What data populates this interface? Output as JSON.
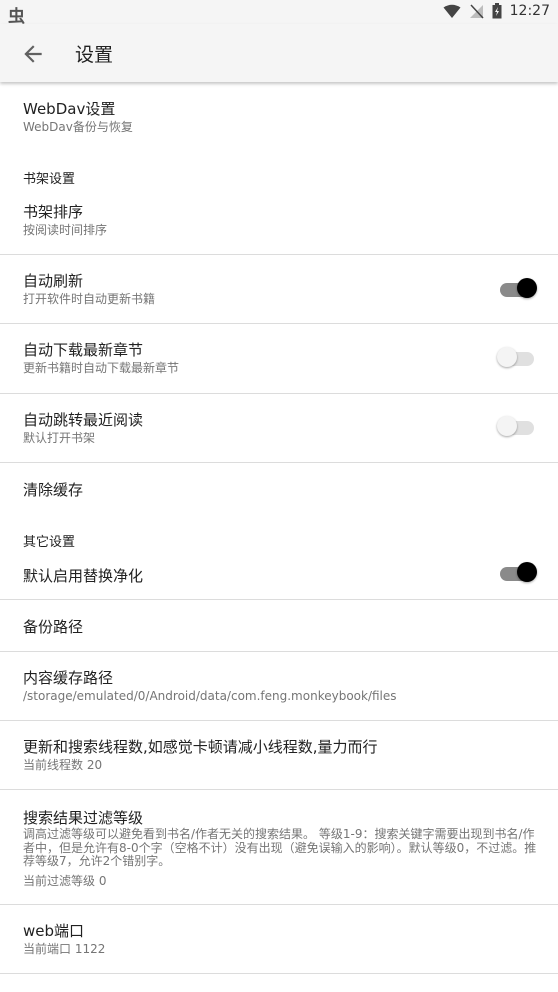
{
  "status_bar": {
    "time": "12:27"
  },
  "toolbar": {
    "title": "设置"
  },
  "sections": {
    "bookshelf_header": "书架设置",
    "other_header": "其它设置"
  },
  "items": {
    "webdav": {
      "title": "WebDav设置",
      "summary": "WebDav备份与恢复"
    },
    "sort": {
      "title": "书架排序",
      "summary": "按阅读时间排序"
    },
    "auto_refresh": {
      "title": "自动刷新",
      "summary": "打开软件时自动更新书籍",
      "enabled": true
    },
    "auto_download": {
      "title": "自动下载最新章节",
      "summary": "更新书籍时自动下载最新章节",
      "enabled": false
    },
    "auto_jump": {
      "title": "自动跳转最近阅读",
      "summary": "默认打开书架",
      "enabled": false
    },
    "clear_cache": {
      "title": "清除缓存"
    },
    "replace_purify": {
      "title": "默认启用替换净化",
      "enabled": true
    },
    "backup_path": {
      "title": "备份路径"
    },
    "cache_path": {
      "title": "内容缓存路径",
      "summary": "/storage/emulated/0/Android/data/com.feng.monkeybook/files"
    },
    "threads": {
      "title": "更新和搜索线程数,如感觉卡顿请减小线程数,量力而行",
      "summary": "当前线程数 20"
    },
    "filter": {
      "title": "搜索结果过滤等级",
      "summary": "调高过滤等级可以避免看到书名/作者无关的搜索结果。 等级1-9：搜索关键字需要出现到书名/作者中，但是允许有8-0个字（空格不计）没有出现（避免误输入的影响）。默认等级0，不过滤。推荐等级7，允许2个错别字。",
      "current": "当前过滤等级 0"
    },
    "web_port": {
      "title": "web端口",
      "summary": "当前端口 1122"
    }
  },
  "icons": {
    "app": "app-notification-icon",
    "wifi": "wifi-icon",
    "signal": "no-signal-icon",
    "battery": "battery-charging-icon",
    "back": "arrow-back-icon"
  }
}
